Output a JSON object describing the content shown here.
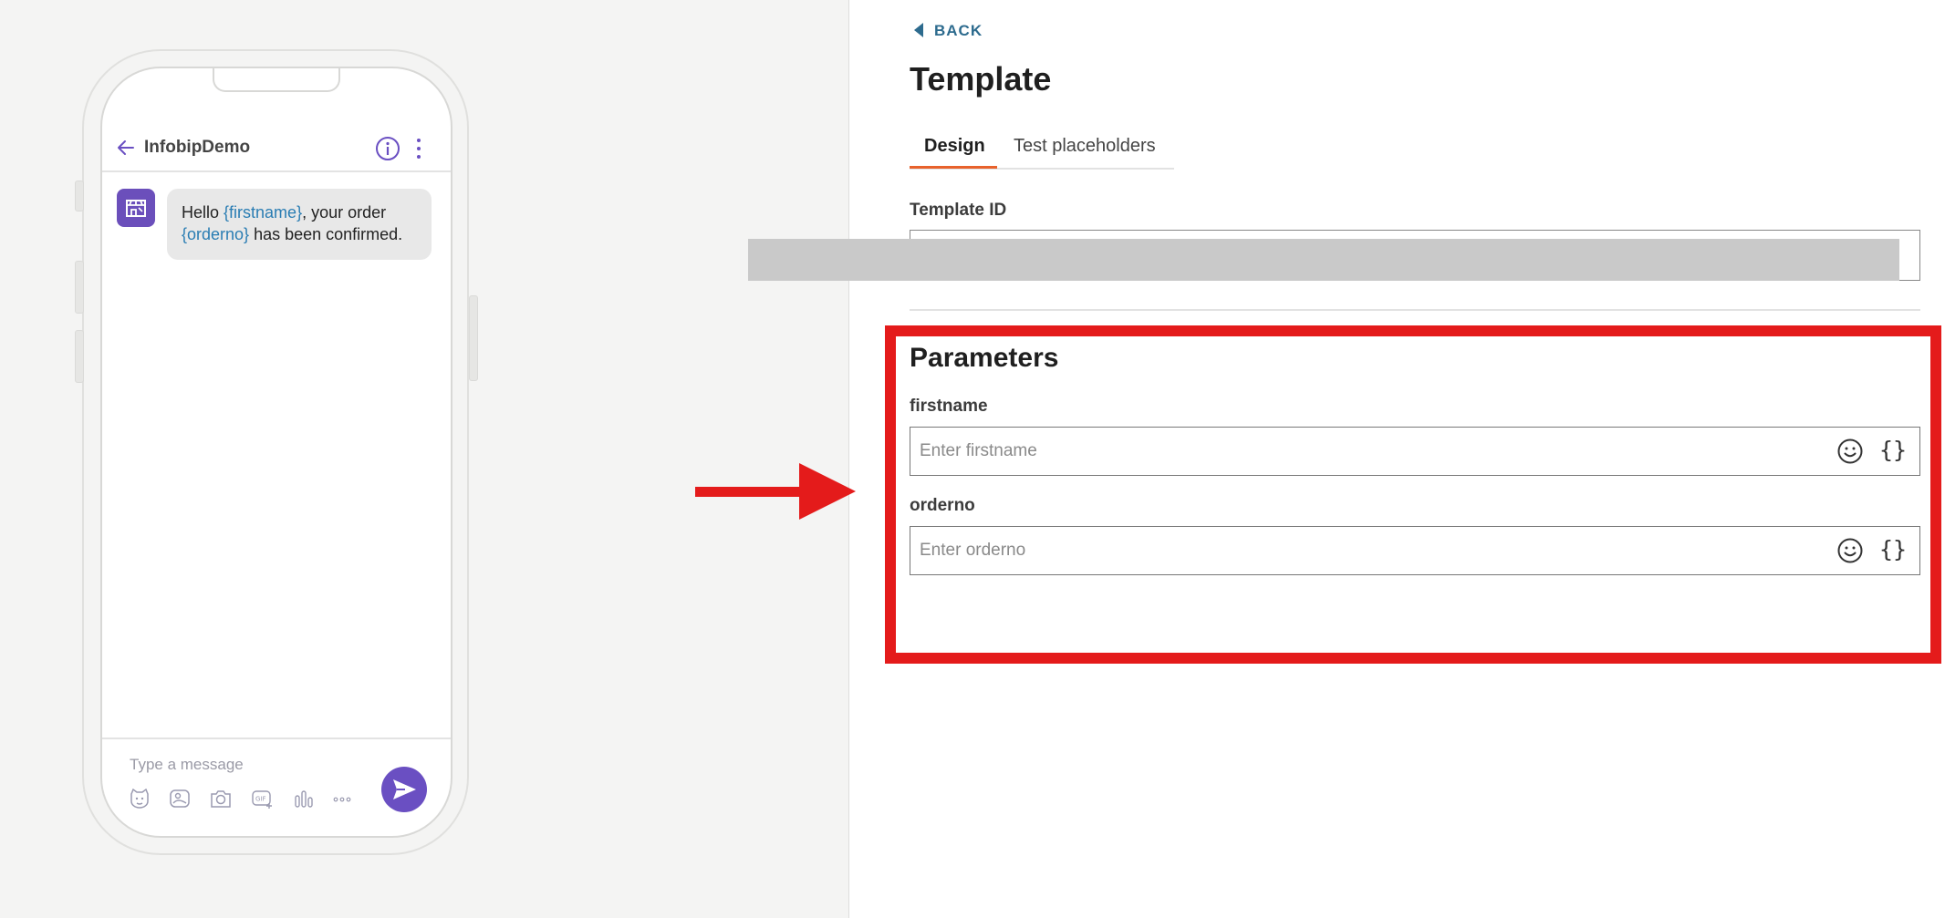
{
  "phone": {
    "chat_title": "InfobipDemo",
    "message": {
      "part1": "Hello ",
      "ph1": "{firstname}",
      "part2": ", your order",
      "ph2": "{orderno}",
      "part3": " has been confirmed."
    },
    "compose_placeholder": "Type a message",
    "tool_icons": [
      "sticker-icon",
      "image-icon",
      "camera-icon",
      "gif-icon",
      "poll-icon",
      "more-icon"
    ],
    "accent_color": "#6a4fc2"
  },
  "panel": {
    "back_label": "BACK",
    "title": "Template",
    "tabs": [
      {
        "label": "Design",
        "active": true
      },
      {
        "label": "Test placeholders",
        "active": false
      }
    ],
    "template_id_label": "Template ID",
    "params_title": "Parameters",
    "params": [
      {
        "label": "firstname",
        "placeholder": "Enter firstname",
        "value": ""
      },
      {
        "label": "orderno",
        "placeholder": "Enter orderno",
        "value": ""
      }
    ],
    "braces_label": "{}",
    "tab_accent_color": "#e8622c",
    "highlight_color": "#e41b1b"
  }
}
